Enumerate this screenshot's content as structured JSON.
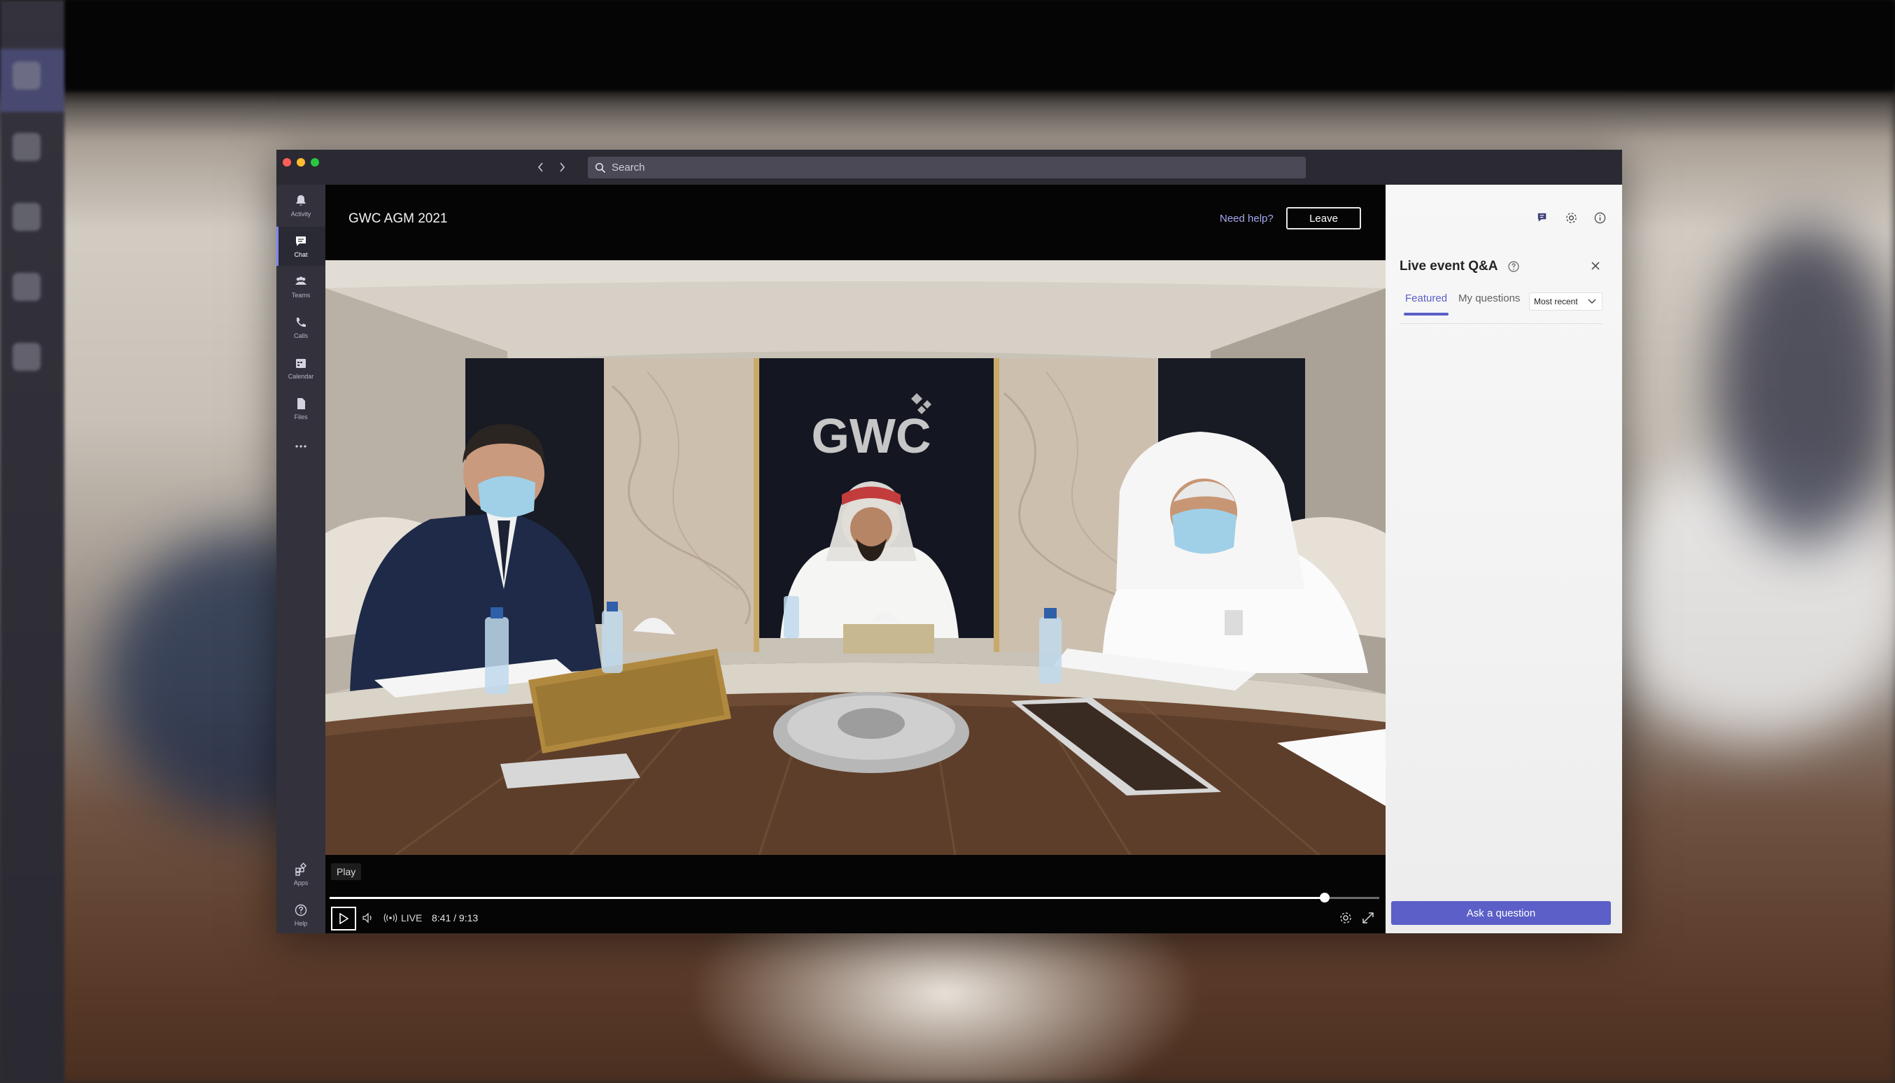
{
  "search": {
    "placeholder": "Search"
  },
  "app_bar": [
    {
      "label": "Activity",
      "icon": "bell-icon"
    },
    {
      "label": "Chat",
      "icon": "chat-icon",
      "active": true
    },
    {
      "label": "Teams",
      "icon": "teams-icon"
    },
    {
      "label": "Calls",
      "icon": "phone-icon"
    },
    {
      "label": "Calendar",
      "icon": "calendar-icon"
    },
    {
      "label": "Files",
      "icon": "file-icon"
    },
    {
      "label": "Apps",
      "icon": "apps-icon"
    },
    {
      "label": "Help",
      "icon": "help-icon"
    }
  ],
  "event": {
    "title": "GWC AGM 2021",
    "need_help": "Need help?",
    "leave": "Leave"
  },
  "video": {
    "logo_text": "GWC",
    "tooltip": "Play",
    "live_label": "LIVE",
    "time": "8:41  /  9:13",
    "progress": 0.948
  },
  "qa": {
    "title": "Live event Q&A",
    "tabs": [
      {
        "label": "Featured",
        "active": true
      },
      {
        "label": "My questions",
        "active": false
      }
    ],
    "sort": "Most recent",
    "ask_button": "Ask a question"
  },
  "colors": {
    "accent": "#5b5fc7",
    "accent_light": "#7f85f5",
    "appbar": "#33323c",
    "titlebar": "#2b2a33"
  }
}
